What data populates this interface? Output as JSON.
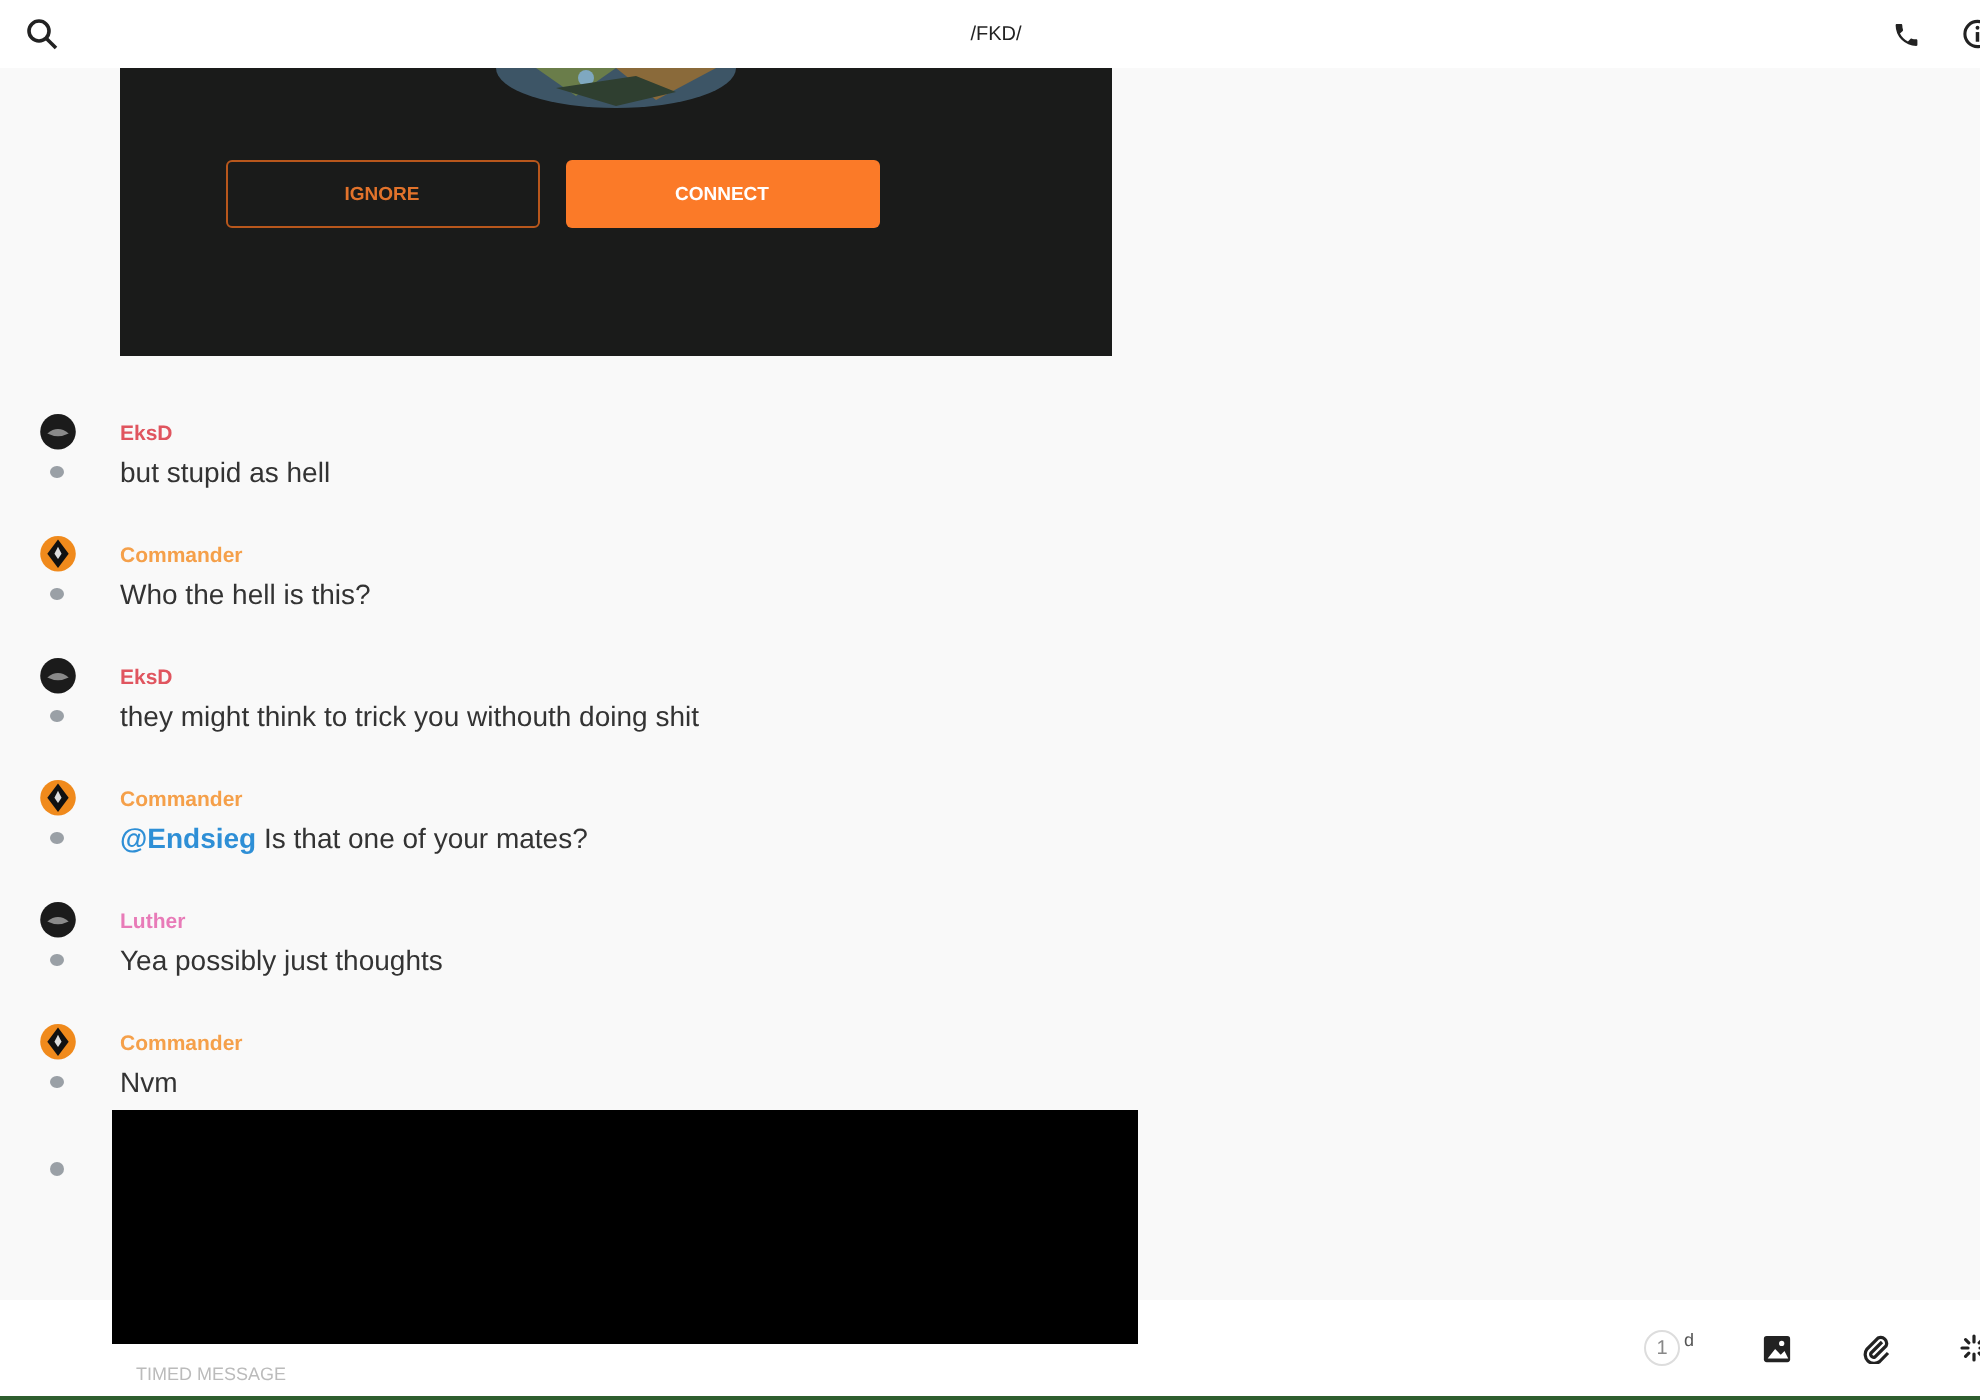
{
  "header": {
    "title": "/FKD/"
  },
  "invite_card": {
    "kind": "picture",
    "buttons": [
      {
        "label": "IGNORE",
        "kind": "outline"
      },
      {
        "label": "CONNECT",
        "kind": "primary"
      }
    ]
  },
  "messages": [
    {
      "author": "EksD",
      "color": "#e0555f",
      "kind": "dark",
      "text": "but stupid as hell"
    },
    {
      "author": "Commander",
      "color": "#f5a04a",
      "kind": "diamond",
      "text": "Who the hell is this?"
    },
    {
      "author": "EksD",
      "color": "#e0555f",
      "kind": "dark",
      "text": "they might think to trick you withouth doing shit"
    },
    {
      "author": "Commander",
      "color": "#f5a04a",
      "kind": "diamond",
      "mention": "@Endsieg",
      "text": "Is that one of your mates?"
    },
    {
      "author": "Luther",
      "color": "#e87bb8",
      "kind": "dark",
      "text": "Yea possibly just thoughts"
    },
    {
      "author": "Commander",
      "color": "#f5a04a",
      "kind": "diamond",
      "text": "Nvm"
    }
  ],
  "composer": {
    "placeholder": "TIMED MESSAGE",
    "timer": "1",
    "timer_unit": "d"
  }
}
